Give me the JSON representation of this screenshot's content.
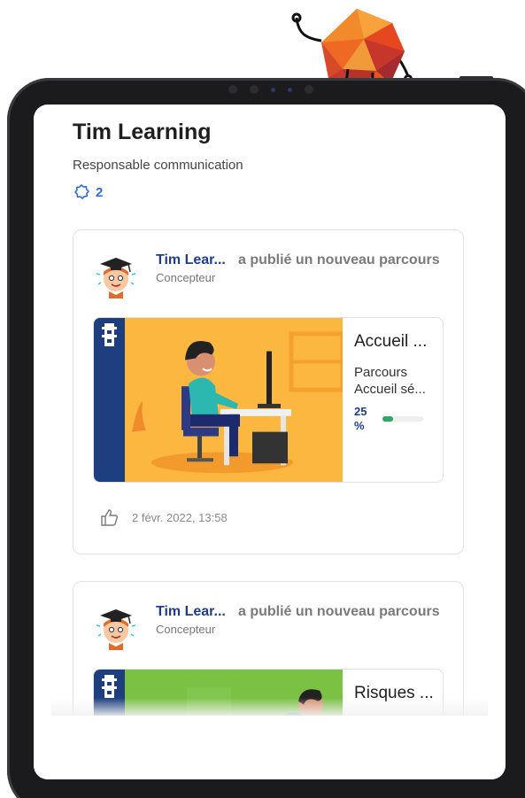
{
  "profile": {
    "name": "Tim Learning",
    "role": "Responsable communication",
    "badge_count": "2"
  },
  "feed": [
    {
      "author": "Tim Lear...",
      "action": "a publié un nouveau parcours",
      "author_role": "Concepteur",
      "course": {
        "title": "Accueil ...",
        "subtitle_line1": "Parcours",
        "subtitle_line2": "Accueil sé...",
        "progress_label_line1": "25",
        "progress_label_line2": "%",
        "progress_percent": 25
      },
      "date": "2 févr. 2022, 13:58"
    },
    {
      "author": "Tim Lear...",
      "action": "a publié un nouveau parcours",
      "author_role": "Concepteur",
      "course": {
        "title": "Risques ..."
      }
    }
  ],
  "colors": {
    "link_blue": "#1f3d8a",
    "badge_blue": "#2a6fd6",
    "strip_blue": "#1d3f7f",
    "progress_green": "#2ea86a",
    "course1_bg": "#fbb73f",
    "course2_bg": "#7ac144"
  },
  "icons": {
    "badge": "badge-icon",
    "like": "thumbs-up-icon",
    "mascot": "d20-mascot-icon"
  }
}
